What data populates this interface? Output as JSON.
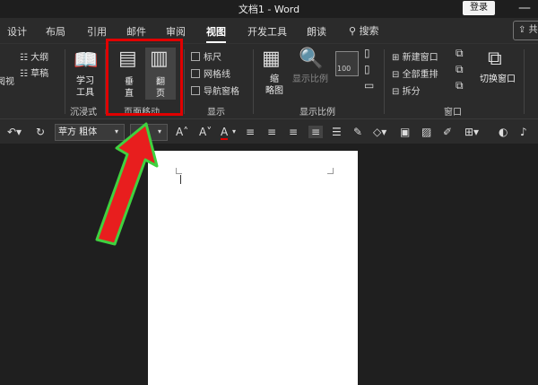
{
  "window": {
    "title": "文档1  -  Word",
    "login_label": "登录",
    "minimize_glyph": "—"
  },
  "tabs": [
    {
      "label": "设计"
    },
    {
      "label": "布局"
    },
    {
      "label": "引用"
    },
    {
      "label": "邮件"
    },
    {
      "label": "审阅"
    },
    {
      "label": "视图",
      "active": true
    },
    {
      "label": "开发工具"
    },
    {
      "label": "朗读"
    }
  ],
  "search_label": "搜索",
  "share_label": "共",
  "ribbon": {
    "view_buttons": {
      "outline": "大纲",
      "draft": "草稿",
      "read": "阅视"
    },
    "immersive": {
      "learning_tools": "学习\n工具",
      "group": "沉浸式"
    },
    "page_move": {
      "vertical": "垂\n直",
      "flip": "翻\n页",
      "group": "页面移动"
    },
    "show": {
      "ruler": "标尺",
      "gridlines": "网格线",
      "nav_pane": "导航窗格",
      "group": "显示"
    },
    "zoom": {
      "thumbnail": "缩\n略图",
      "zoom": "显示比例",
      "percent": "100",
      "group": "显示比例"
    },
    "window": {
      "new_window": "新建窗口",
      "arrange_all": "全部重排",
      "split": "拆分",
      "switch": "切换窗口",
      "group": "窗口"
    }
  },
  "format_bar": {
    "font_name": "苹方 粗体",
    "font_size": ""
  },
  "colors": {
    "highlight": "#e00000",
    "arrow_fill": "#e81e1e",
    "arrow_stroke": "#3fd13f"
  }
}
